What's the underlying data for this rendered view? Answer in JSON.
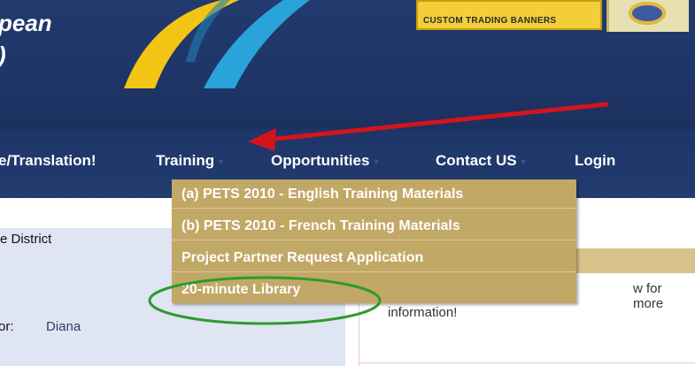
{
  "header": {
    "brand_line1": "pean",
    "brand_line2": ")",
    "banner_ad_text": "CUSTOM TRADING BANNERS"
  },
  "nav": {
    "items": [
      {
        "label": "e/Translation!",
        "has_arrow": false
      },
      {
        "label": "Training",
        "has_arrow": true
      },
      {
        "label": "Opportunities",
        "has_arrow": true
      },
      {
        "label": "Contact US",
        "has_arrow": true
      },
      {
        "label": "Login",
        "has_arrow": false
      }
    ],
    "dropdown_arrow": "▼"
  },
  "dropdown": {
    "items": [
      "(a) PETS 2010 - English Training Materials",
      "(b) PETS 2010 - French Training Materials",
      "Project Partner Request Application",
      "20-minute Library"
    ]
  },
  "content": {
    "district_label": "e District",
    "director_label": "or:",
    "director_value": "Diana",
    "right_text_line1": "w for more",
    "right_text_line2": "information!"
  },
  "colors": {
    "header_bg": "#1e3567",
    "dropdown_bg": "#c2a866",
    "annotation_arrow": "#d4141c",
    "annotation_ellipse": "#2e9a2e"
  }
}
